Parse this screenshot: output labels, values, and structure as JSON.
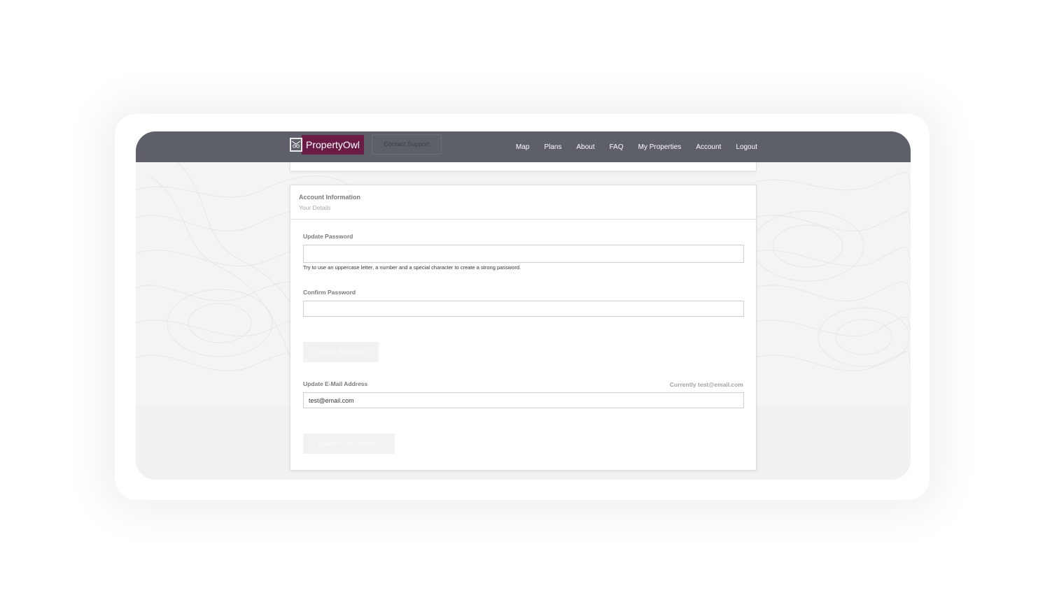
{
  "brand": {
    "name": "PropertyOwl",
    "color": "#6a1c47"
  },
  "header": {
    "support_button": "Contact Support",
    "nav": [
      "Map",
      "Plans",
      "About",
      "FAQ",
      "My Properties",
      "Account",
      "Logout"
    ]
  },
  "card": {
    "title": "Account Information",
    "subtitle": "Your Details"
  },
  "password": {
    "label": "Update Password",
    "value": "",
    "hint": "Try to use an uppercase letter, a number and a special character to create a strong password.",
    "confirm_label": "Confirm Password",
    "confirm_value": "",
    "button": "Update Password"
  },
  "email": {
    "label": "Update E-Mail Address",
    "current": "Currently test@email.com",
    "value": "test@email.com",
    "button": "Update E-Mail Address"
  }
}
